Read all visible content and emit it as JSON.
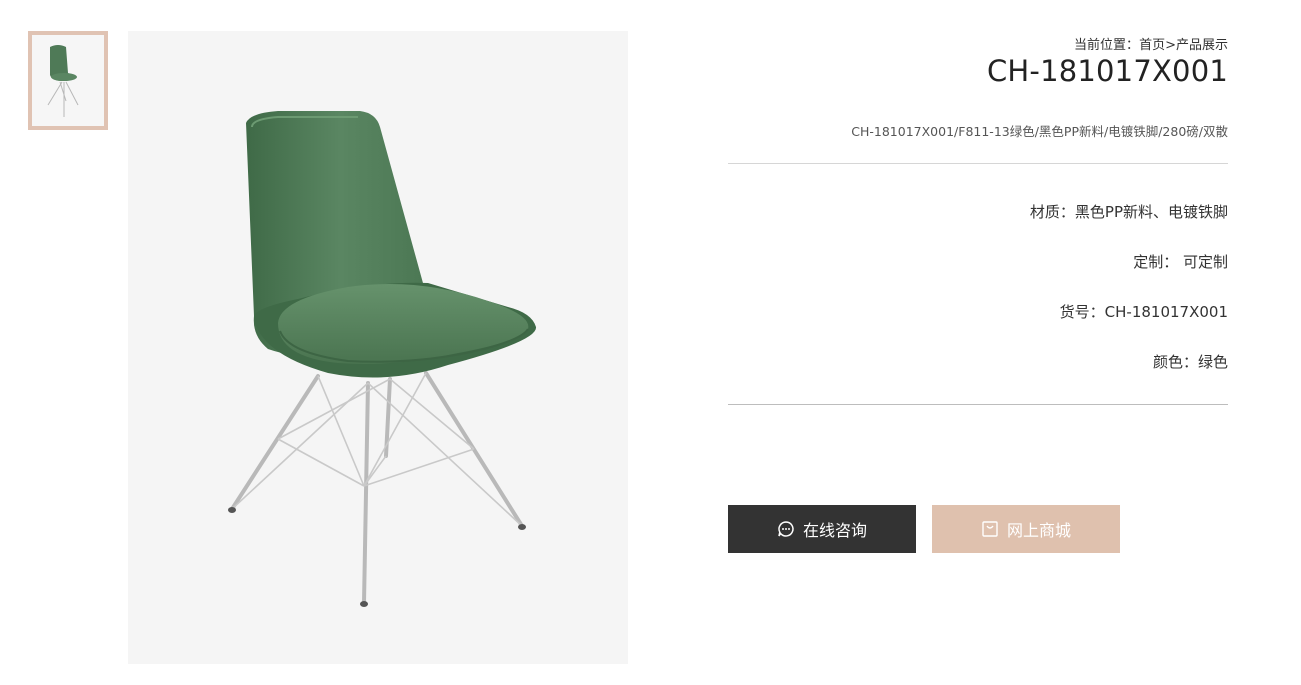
{
  "gallery": {
    "thumbnail_alt": "chair-thumbnail",
    "main_image_alt": "green-chair-photo"
  },
  "breadcrumb": {
    "prefix": "当前位置：",
    "home": "首页",
    "separator": ">",
    "current": "产品展示"
  },
  "product": {
    "title": "CH-181017X001",
    "description": "CH-181017X001/F811-13绿色/黑色PP新料/电镀铁脚/280磅/双散",
    "specs": [
      {
        "text": "材质：黑色PP新料、电镀铁脚"
      },
      {
        "text": "定制： 可定制"
      },
      {
        "text": "货号：CH-181017X001"
      },
      {
        "text": "颜色：绿色"
      }
    ]
  },
  "actions": {
    "consult_label": "在线咨询",
    "consult_icon": "chat-bubble-icon",
    "shop_label": "网上商城",
    "shop_icon": "shopping-bag-icon"
  },
  "colors": {
    "accent": "#dfc1ae",
    "dark_button": "#333333",
    "chair_green": "#4f7a57"
  }
}
